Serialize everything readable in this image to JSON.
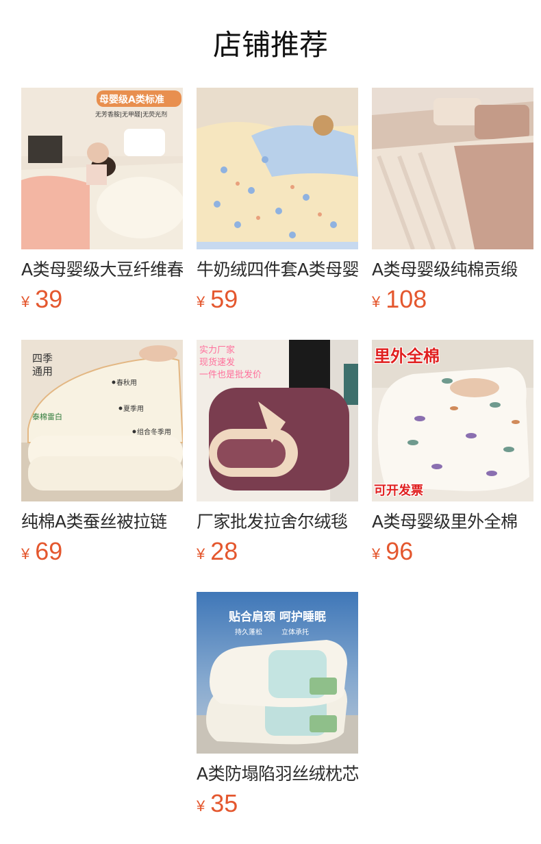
{
  "section": {
    "title": "店铺推荐"
  },
  "currency_symbol": "¥",
  "products": [
    {
      "title": "A类母婴级大豆纤维春",
      "price": "39",
      "image_badges": [
        "母婴级A类标准",
        "无芳香胺|无甲醛|无荧光剂"
      ]
    },
    {
      "title": "牛奶绒四件套A类母婴",
      "price": "59",
      "image_badges": []
    },
    {
      "title": "A类母婴级纯棉贡缎",
      "price": "108",
      "image_badges": []
    },
    {
      "title": "纯棉A类蚕丝被拉链",
      "price": "69",
      "image_badges": [
        "四季",
        "通用",
        "春秋用",
        "夏季用",
        "组合冬季用",
        "泰棉雷白"
      ]
    },
    {
      "title": "厂家批发拉舍尔绒毯",
      "price": "28",
      "image_badges": [
        "实力厂家",
        "现货速发",
        "一件也是批发价"
      ]
    },
    {
      "title": "A类母婴级里外全棉",
      "price": "96",
      "image_badges": [
        "里外全棉",
        "可开发票"
      ]
    },
    {
      "title": "A类防塌陷羽丝绒枕芯",
      "price": "35",
      "image_badges": [
        "贴合肩颈 呵护睡眠",
        "持久蓬松",
        "立体承托"
      ]
    }
  ],
  "colors": {
    "price": "#e4572e",
    "badge_orange": "#e88f4f",
    "badge_red": "#e02020"
  }
}
